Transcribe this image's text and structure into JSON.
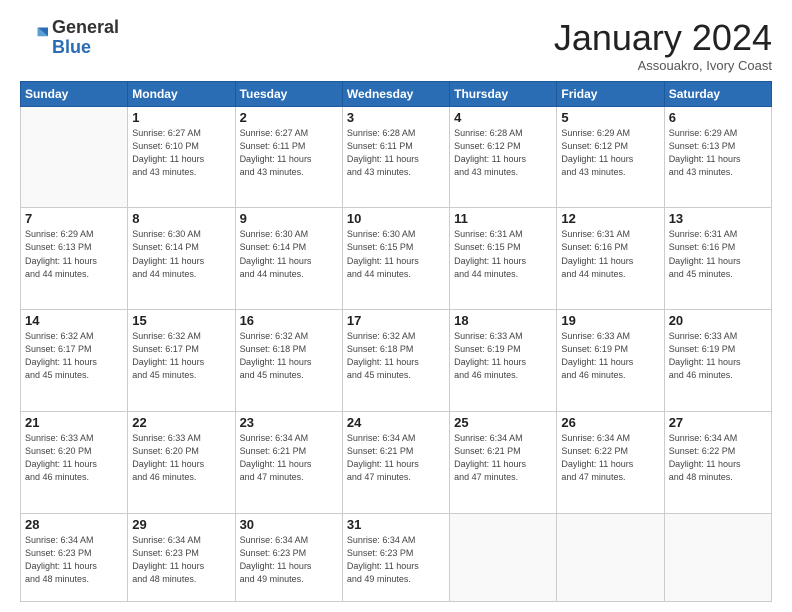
{
  "logo": {
    "general": "General",
    "blue": "Blue"
  },
  "title": "January 2024",
  "subtitle": "Assouakro, Ivory Coast",
  "days_header": [
    "Sunday",
    "Monday",
    "Tuesday",
    "Wednesday",
    "Thursday",
    "Friday",
    "Saturday"
  ],
  "weeks": [
    [
      {
        "day": "",
        "info": ""
      },
      {
        "day": "1",
        "info": "Sunrise: 6:27 AM\nSunset: 6:10 PM\nDaylight: 11 hours\nand 43 minutes."
      },
      {
        "day": "2",
        "info": "Sunrise: 6:27 AM\nSunset: 6:11 PM\nDaylight: 11 hours\nand 43 minutes."
      },
      {
        "day": "3",
        "info": "Sunrise: 6:28 AM\nSunset: 6:11 PM\nDaylight: 11 hours\nand 43 minutes."
      },
      {
        "day": "4",
        "info": "Sunrise: 6:28 AM\nSunset: 6:12 PM\nDaylight: 11 hours\nand 43 minutes."
      },
      {
        "day": "5",
        "info": "Sunrise: 6:29 AM\nSunset: 6:12 PM\nDaylight: 11 hours\nand 43 minutes."
      },
      {
        "day": "6",
        "info": "Sunrise: 6:29 AM\nSunset: 6:13 PM\nDaylight: 11 hours\nand 43 minutes."
      }
    ],
    [
      {
        "day": "7",
        "info": "Sunrise: 6:29 AM\nSunset: 6:13 PM\nDaylight: 11 hours\nand 44 minutes."
      },
      {
        "day": "8",
        "info": "Sunrise: 6:30 AM\nSunset: 6:14 PM\nDaylight: 11 hours\nand 44 minutes."
      },
      {
        "day": "9",
        "info": "Sunrise: 6:30 AM\nSunset: 6:14 PM\nDaylight: 11 hours\nand 44 minutes."
      },
      {
        "day": "10",
        "info": "Sunrise: 6:30 AM\nSunset: 6:15 PM\nDaylight: 11 hours\nand 44 minutes."
      },
      {
        "day": "11",
        "info": "Sunrise: 6:31 AM\nSunset: 6:15 PM\nDaylight: 11 hours\nand 44 minutes."
      },
      {
        "day": "12",
        "info": "Sunrise: 6:31 AM\nSunset: 6:16 PM\nDaylight: 11 hours\nand 44 minutes."
      },
      {
        "day": "13",
        "info": "Sunrise: 6:31 AM\nSunset: 6:16 PM\nDaylight: 11 hours\nand 45 minutes."
      }
    ],
    [
      {
        "day": "14",
        "info": "Sunrise: 6:32 AM\nSunset: 6:17 PM\nDaylight: 11 hours\nand 45 minutes."
      },
      {
        "day": "15",
        "info": "Sunrise: 6:32 AM\nSunset: 6:17 PM\nDaylight: 11 hours\nand 45 minutes."
      },
      {
        "day": "16",
        "info": "Sunrise: 6:32 AM\nSunset: 6:18 PM\nDaylight: 11 hours\nand 45 minutes."
      },
      {
        "day": "17",
        "info": "Sunrise: 6:32 AM\nSunset: 6:18 PM\nDaylight: 11 hours\nand 45 minutes."
      },
      {
        "day": "18",
        "info": "Sunrise: 6:33 AM\nSunset: 6:19 PM\nDaylight: 11 hours\nand 46 minutes."
      },
      {
        "day": "19",
        "info": "Sunrise: 6:33 AM\nSunset: 6:19 PM\nDaylight: 11 hours\nand 46 minutes."
      },
      {
        "day": "20",
        "info": "Sunrise: 6:33 AM\nSunset: 6:19 PM\nDaylight: 11 hours\nand 46 minutes."
      }
    ],
    [
      {
        "day": "21",
        "info": "Sunrise: 6:33 AM\nSunset: 6:20 PM\nDaylight: 11 hours\nand 46 minutes."
      },
      {
        "day": "22",
        "info": "Sunrise: 6:33 AM\nSunset: 6:20 PM\nDaylight: 11 hours\nand 46 minutes."
      },
      {
        "day": "23",
        "info": "Sunrise: 6:34 AM\nSunset: 6:21 PM\nDaylight: 11 hours\nand 47 minutes."
      },
      {
        "day": "24",
        "info": "Sunrise: 6:34 AM\nSunset: 6:21 PM\nDaylight: 11 hours\nand 47 minutes."
      },
      {
        "day": "25",
        "info": "Sunrise: 6:34 AM\nSunset: 6:21 PM\nDaylight: 11 hours\nand 47 minutes."
      },
      {
        "day": "26",
        "info": "Sunrise: 6:34 AM\nSunset: 6:22 PM\nDaylight: 11 hours\nand 47 minutes."
      },
      {
        "day": "27",
        "info": "Sunrise: 6:34 AM\nSunset: 6:22 PM\nDaylight: 11 hours\nand 48 minutes."
      }
    ],
    [
      {
        "day": "28",
        "info": "Sunrise: 6:34 AM\nSunset: 6:23 PM\nDaylight: 11 hours\nand 48 minutes."
      },
      {
        "day": "29",
        "info": "Sunrise: 6:34 AM\nSunset: 6:23 PM\nDaylight: 11 hours\nand 48 minutes."
      },
      {
        "day": "30",
        "info": "Sunrise: 6:34 AM\nSunset: 6:23 PM\nDaylight: 11 hours\nand 49 minutes."
      },
      {
        "day": "31",
        "info": "Sunrise: 6:34 AM\nSunset: 6:23 PM\nDaylight: 11 hours\nand 49 minutes."
      },
      {
        "day": "",
        "info": ""
      },
      {
        "day": "",
        "info": ""
      },
      {
        "day": "",
        "info": ""
      }
    ]
  ]
}
